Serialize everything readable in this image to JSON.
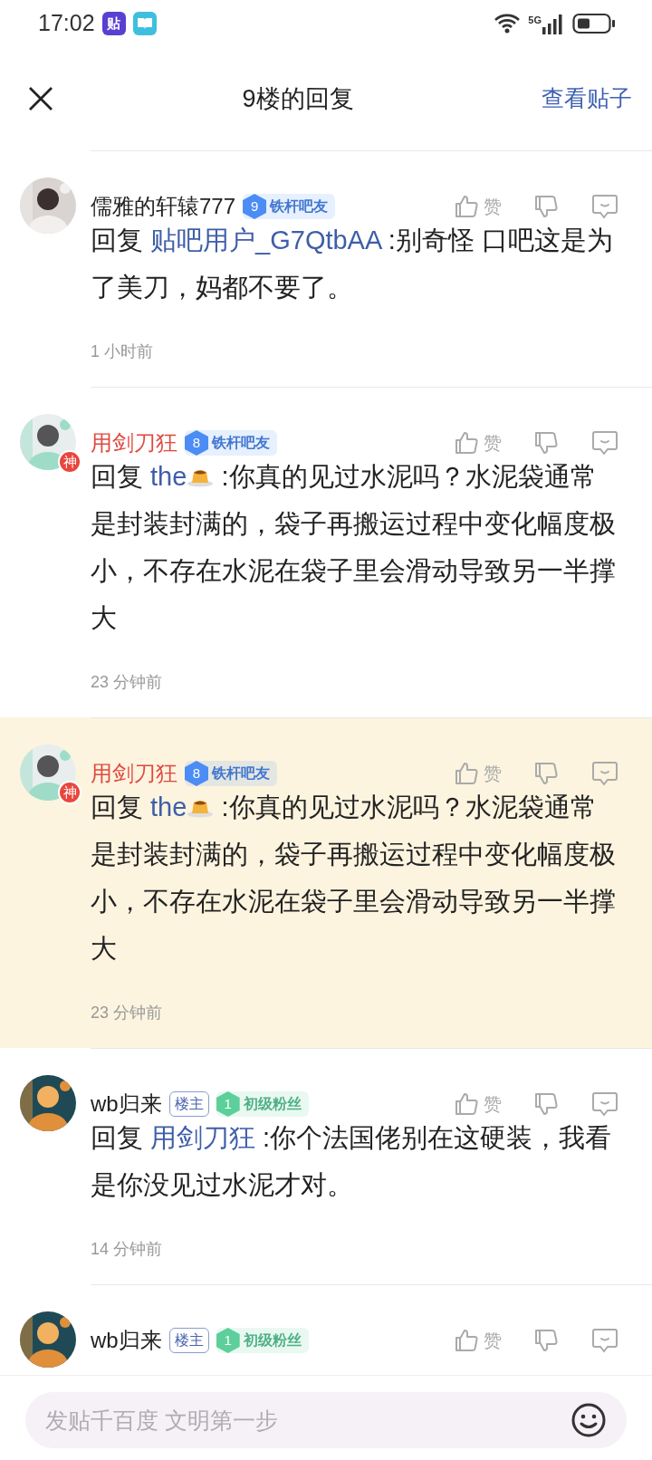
{
  "status_bar": {
    "time": "17:02",
    "app_icons": [
      {
        "kind": "tieba",
        "label": "贴"
      },
      {
        "kind": "book"
      }
    ],
    "network": "5G"
  },
  "header": {
    "title": "9楼的回复",
    "link": "查看贴子"
  },
  "comments": [
    {
      "author": "儒雅的轩辕777",
      "red_name": false,
      "badges": [
        {
          "kind": "level",
          "number": "9",
          "label": "铁杆吧友",
          "color": "#4c8cf5"
        }
      ],
      "reply_prefix": "回复",
      "mention": "贴吧用户_G7QtbAA",
      "text": " :别奇怪 口吧这是为了美刀，妈都不要了。",
      "time": "1 小时前",
      "like_label": "赞",
      "highlighted": false
    },
    {
      "author": "用剑刀狂",
      "red_name": true,
      "avatar_badge": "神",
      "badges": [
        {
          "kind": "level",
          "number": "8",
          "label": "铁杆吧友",
          "color": "#4c8cf5"
        }
      ],
      "reply_prefix": "回复",
      "mention": "the",
      "mention_emoji": true,
      "text": " :你真的见过水泥吗？水泥袋通常是封装封满的，袋子再搬运过程中变化幅度极小，不存在水泥在袋子里会滑动导致另一半撑大",
      "time": "23 分钟前",
      "like_label": "赞",
      "highlighted": false
    },
    {
      "author": "用剑刀狂",
      "red_name": true,
      "avatar_badge": "神",
      "badges": [
        {
          "kind": "level",
          "number": "8",
          "label": "铁杆吧友",
          "color": "#4c8cf5"
        }
      ],
      "reply_prefix": "回复",
      "mention": "the",
      "mention_emoji": true,
      "text": " :你真的见过水泥吗？水泥袋通常是封装封满的，袋子再搬运过程中变化幅度极小，不存在水泥在袋子里会滑动导致另一半撑大",
      "time": "23 分钟前",
      "like_label": "赞",
      "highlighted": true
    },
    {
      "author": "wb归来",
      "red_name": false,
      "badges": [
        {
          "kind": "owner",
          "label": "楼主"
        },
        {
          "kind": "level",
          "number": "1",
          "label": "初级粉丝",
          "color": "#5ccf9b"
        }
      ],
      "reply_prefix": "回复",
      "mention": "用剑刀狂",
      "text": " :你个法国佬别在这硬装，我看是你没见过水泥才对。",
      "time": "14 分钟前",
      "like_label": "赞",
      "highlighted": false
    },
    {
      "author": "wb归来",
      "red_name": false,
      "badges": [
        {
          "kind": "owner",
          "label": "楼主"
        },
        {
          "kind": "level",
          "number": "1",
          "label": "初级粉丝",
          "color": "#5ccf9b"
        }
      ],
      "like_label": "赞",
      "highlighted": false
    }
  ],
  "input": {
    "placeholder": "发贴千百度 文明第一步"
  }
}
